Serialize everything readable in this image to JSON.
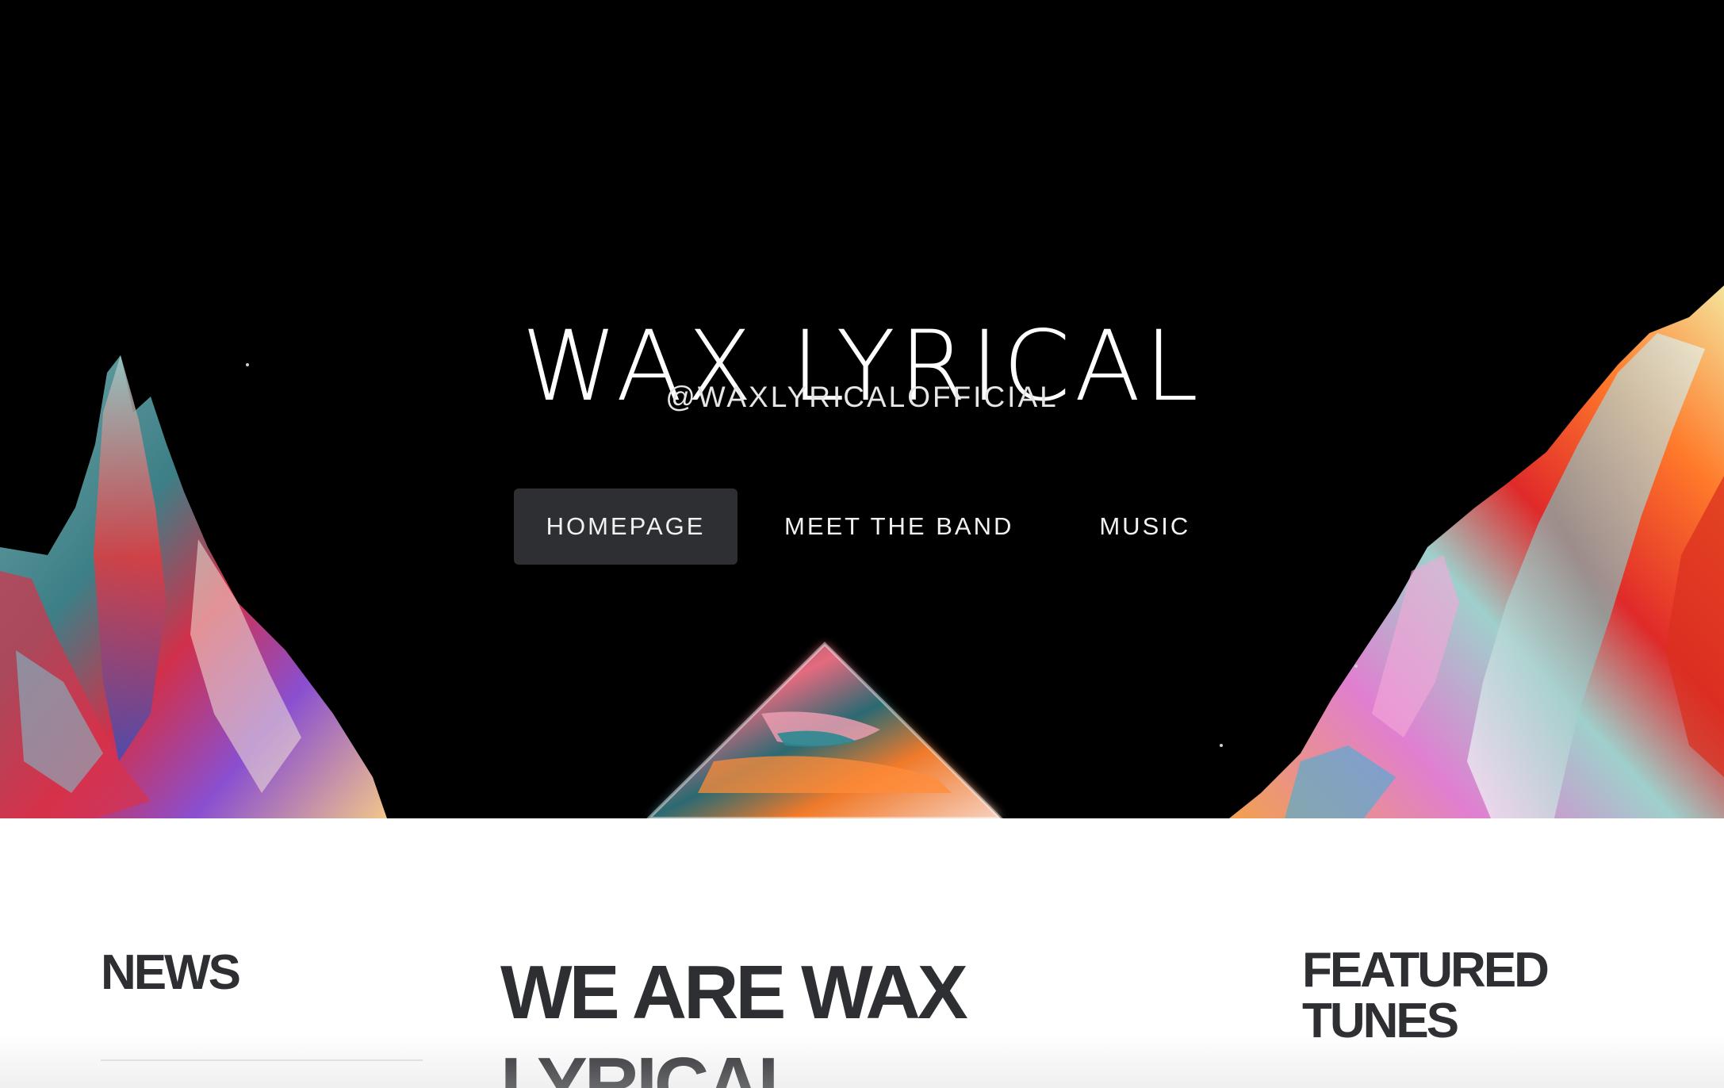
{
  "hero": {
    "title": "WAX LYRICAL",
    "handle": "@WAXLYRICALOFFICIAL",
    "background_color": "#000000"
  },
  "nav": {
    "items": [
      {
        "label": "HOMEPAGE",
        "active": true
      },
      {
        "label": "MEET THE BAND",
        "active": false
      },
      {
        "label": "MUSIC",
        "active": false
      }
    ],
    "active_background": "#2e2f33"
  },
  "content": {
    "news_heading": "NEWS",
    "main_heading": "WE ARE WAX LYRICAL",
    "featured_heading": "FEATURED TUNES",
    "text_color": "#2e2f33"
  },
  "icons": {
    "hero_art": "abstract-paint-mountains-image"
  }
}
